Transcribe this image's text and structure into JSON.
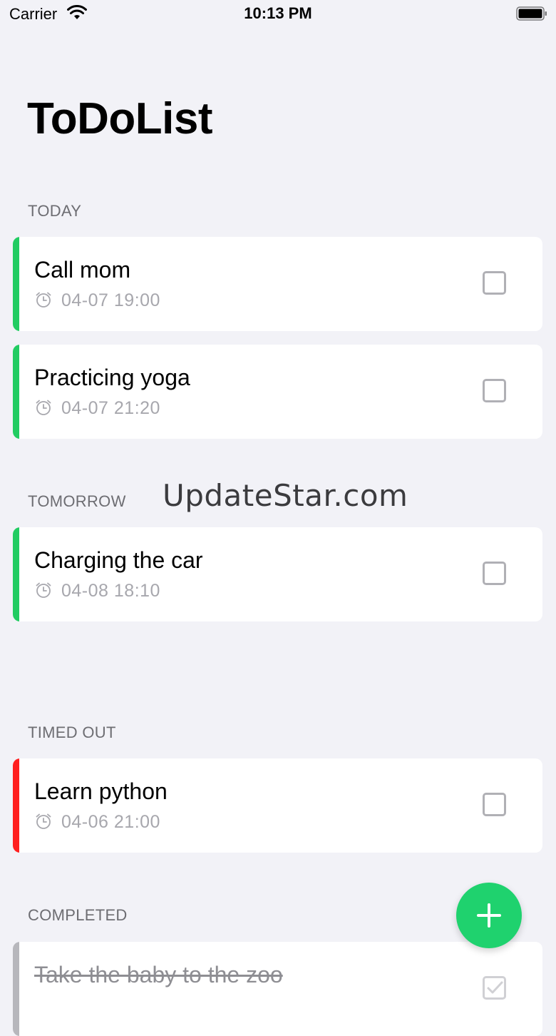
{
  "status_bar": {
    "carrier": "Carrier",
    "time": "10:13 PM"
  },
  "title": "ToDoList",
  "watermark": "UpdateStar.com",
  "colors": {
    "upcoming": "#22cc62",
    "timed_out": "#ff1f1f",
    "completed": "#b7b7bc",
    "fab": "#1fd26e"
  },
  "sections": [
    {
      "header": "TODAY",
      "tasks": [
        {
          "title": "Call mom",
          "time": "04-07 19:00",
          "done": false
        },
        {
          "title": "Practicing yoga",
          "time": "04-07 21:20",
          "done": false
        }
      ]
    },
    {
      "header": "TOMORROW",
      "tasks": [
        {
          "title": "Charging the car",
          "time": "04-08 18:10",
          "done": false
        }
      ]
    },
    {
      "header": "TIMED OUT",
      "tasks": [
        {
          "title": "Learn python",
          "time": "04-06 21:00",
          "done": false
        }
      ]
    },
    {
      "header": "COMPLETED",
      "tasks": [
        {
          "title": "Take the baby to the zoo",
          "time": "",
          "done": true
        }
      ]
    }
  ],
  "icons": {
    "clock": "alarm-clock-icon",
    "add": "plus-icon",
    "wifi": "wifi-icon",
    "battery": "battery-icon"
  }
}
